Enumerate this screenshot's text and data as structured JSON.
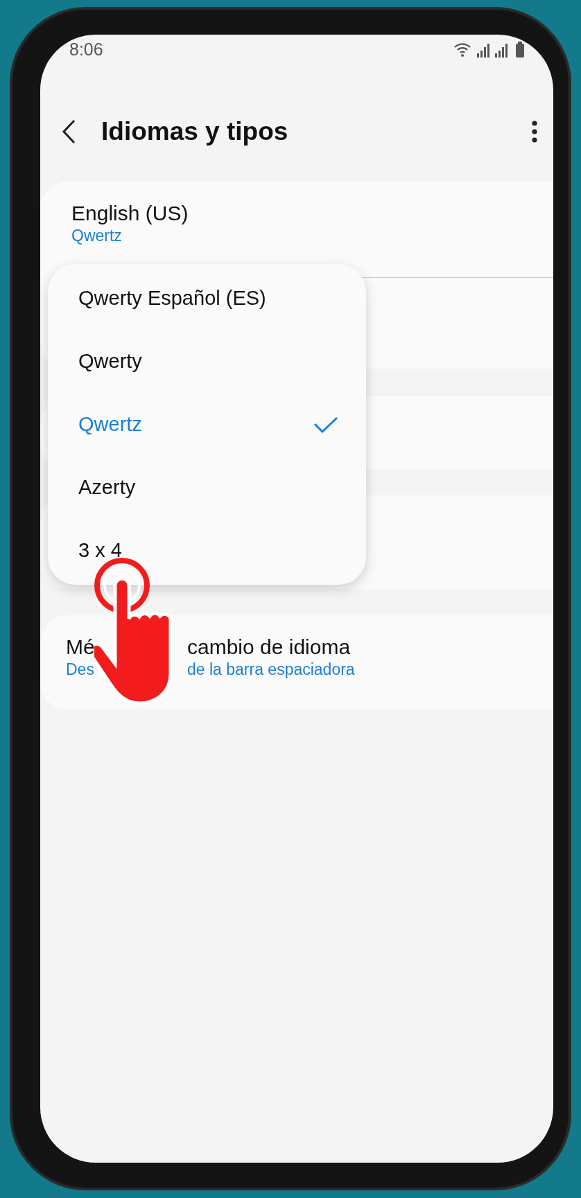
{
  "status_bar": {
    "time": "8:06"
  },
  "header": {
    "title": "Idiomas y tipos"
  },
  "language": {
    "title": "English (US)",
    "subtitle": "Qwertz"
  },
  "switch_method": {
    "title_parts": [
      "Mé",
      "cambio de idioma"
    ],
    "subtitle_parts": [
      "Des",
      "de la barra espaciadora"
    ]
  },
  "layout_menu": {
    "options": [
      {
        "label": "Qwerty Español (ES)",
        "selected": false
      },
      {
        "label": "Qwerty",
        "selected": false
      },
      {
        "label": "Qwertz",
        "selected": true
      },
      {
        "label": "Azerty",
        "selected": false
      },
      {
        "label": "3 x 4",
        "selected": false
      }
    ]
  }
}
